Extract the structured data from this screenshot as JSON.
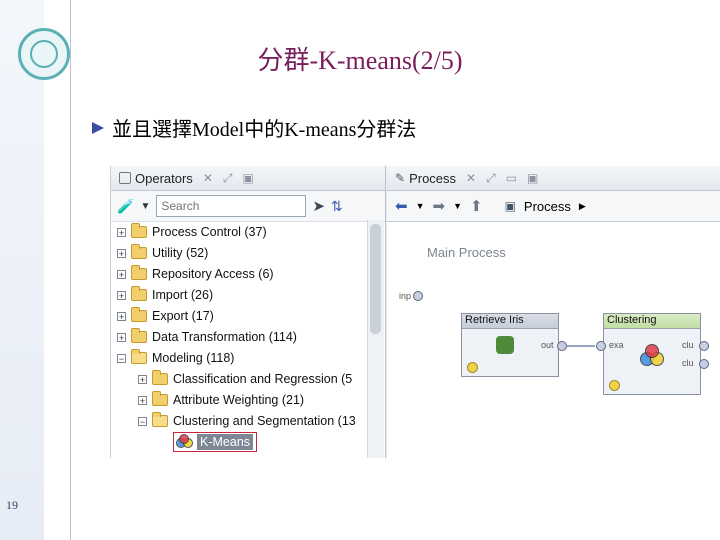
{
  "slide": {
    "title": "分群-K-means(2/5)",
    "bullet": "並且選擇Model中的K-means分群法",
    "page_number": "19"
  },
  "operators_panel": {
    "tab_label": "Operators",
    "search_placeholder": "Search",
    "tree": [
      {
        "label": "Process Control (37)",
        "level": 0,
        "expanded": false
      },
      {
        "label": "Utility (52)",
        "level": 0,
        "expanded": false
      },
      {
        "label": "Repository Access (6)",
        "level": 0,
        "expanded": false
      },
      {
        "label": "Import (26)",
        "level": 0,
        "expanded": false
      },
      {
        "label": "Export (17)",
        "level": 0,
        "expanded": false
      },
      {
        "label": "Data Transformation (114)",
        "level": 0,
        "expanded": false
      },
      {
        "label": "Modeling (118)",
        "level": 0,
        "expanded": true
      },
      {
        "label": "Classification and Regression (5",
        "level": 1,
        "expanded": false
      },
      {
        "label": "Attribute Weighting (21)",
        "level": 1,
        "expanded": false
      },
      {
        "label": "Clustering and Segmentation (13",
        "level": 1,
        "expanded": true
      }
    ],
    "selected_operator": "K-Means"
  },
  "process_panel": {
    "tab_label": "Process",
    "breadcrumb": "Process",
    "canvas_title": "Main Process",
    "input_port": "inp",
    "operators": [
      {
        "title": "Retrieve Iris",
        "ports_out": [
          "out"
        ]
      },
      {
        "title": "Clustering",
        "ports_in": [
          "exa"
        ],
        "ports_out": [
          "clu",
          "clu"
        ]
      }
    ]
  },
  "colors": {
    "title": "#7a1f5c",
    "bullet": "#3b4fa0",
    "selection_border": "#c5283d"
  }
}
